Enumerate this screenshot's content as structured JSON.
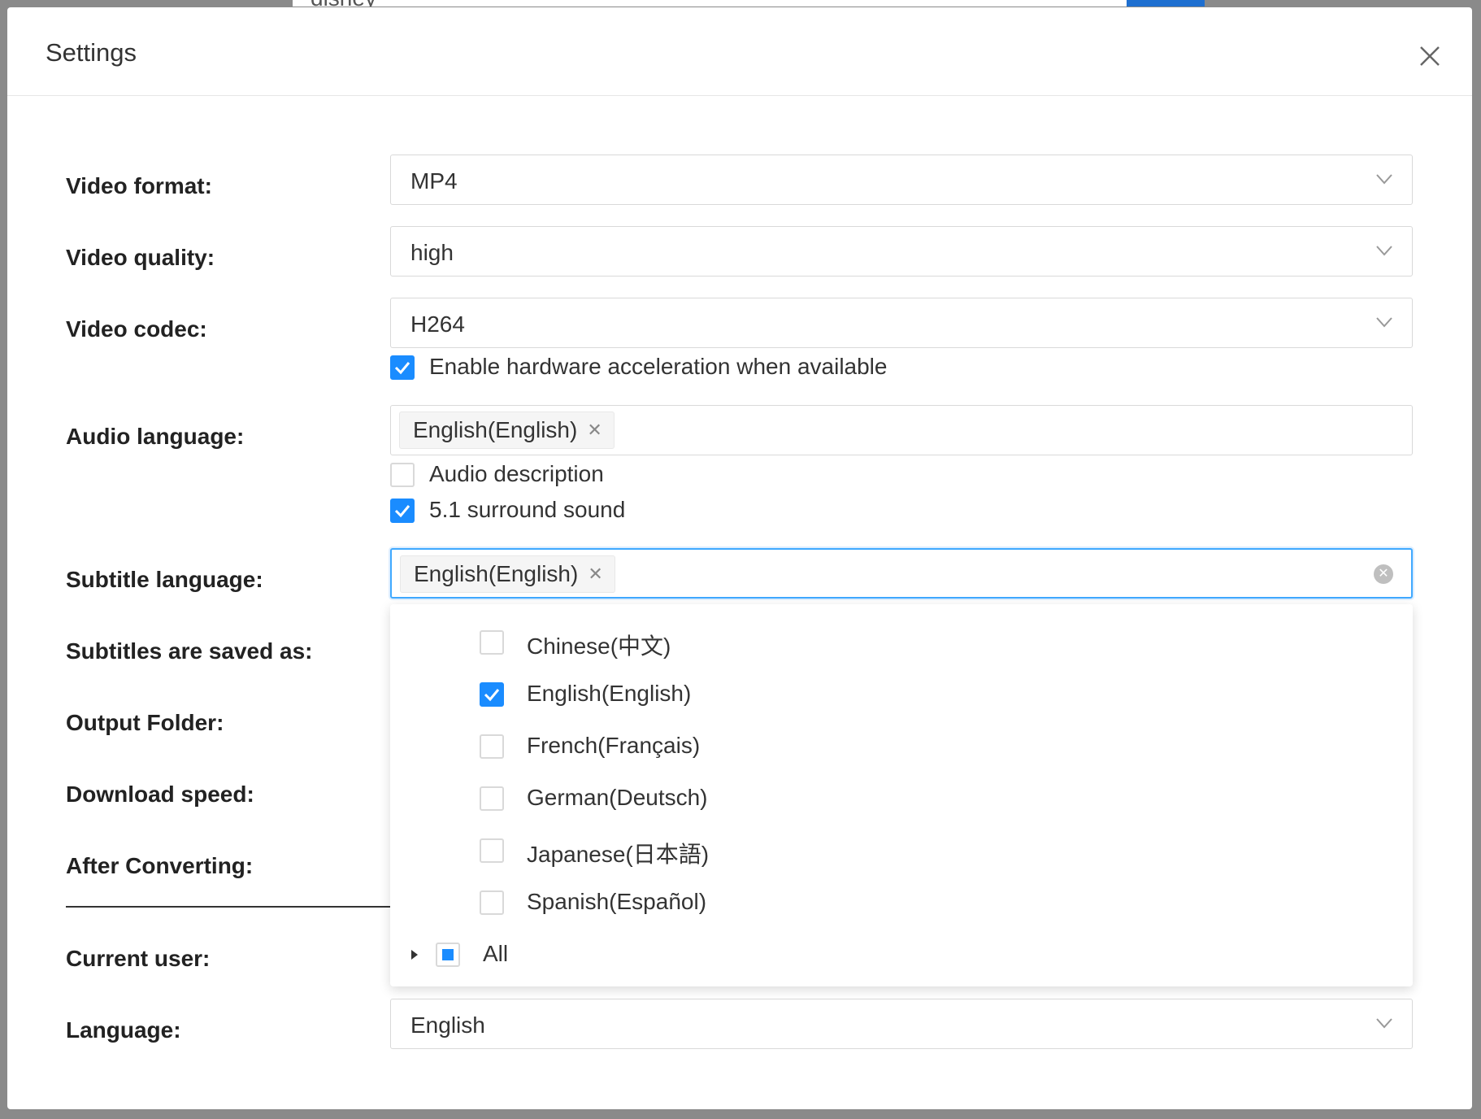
{
  "background": {
    "search_text": "disney"
  },
  "dialog": {
    "title": "Settings"
  },
  "labels": {
    "video_format": "Video format:",
    "video_quality": "Video quality:",
    "video_codec": "Video codec:",
    "audio_language": "Audio language:",
    "subtitle_language": "Subtitle language:",
    "subtitles_saved_as": "Subtitles are saved as:",
    "output_folder": "Output Folder:",
    "download_speed": "Download speed:",
    "after_converting": "After Converting:",
    "current_user": "Current user:",
    "language": "Language:"
  },
  "fields": {
    "video_format": "MP4",
    "video_quality": "high",
    "video_codec": "H264",
    "language": "English"
  },
  "checkboxes": {
    "hardware_acceleration": {
      "label": "Enable hardware acceleration when available",
      "checked": true
    },
    "audio_description": {
      "label": "Audio description",
      "checked": false
    },
    "surround_sound": {
      "label": "5.1 surround sound",
      "checked": true
    }
  },
  "audio_language_tags": [
    "English(English)"
  ],
  "subtitle_language_tags": [
    "English(English)"
  ],
  "subtitle_dropdown": {
    "options": [
      {
        "label": "Chinese(中文)",
        "checked": false
      },
      {
        "label": "English(English)",
        "checked": true
      },
      {
        "label": "French(Français)",
        "checked": false
      },
      {
        "label": "German(Deutsch)",
        "checked": false
      },
      {
        "label": "Japanese(日本語)",
        "checked": false
      },
      {
        "label": "Spanish(Español)",
        "checked": false
      }
    ],
    "all_label": "All",
    "all_state": "indeterminate"
  },
  "colors": {
    "accent": "#1a8cff",
    "focus_border": "#40a9ff"
  }
}
